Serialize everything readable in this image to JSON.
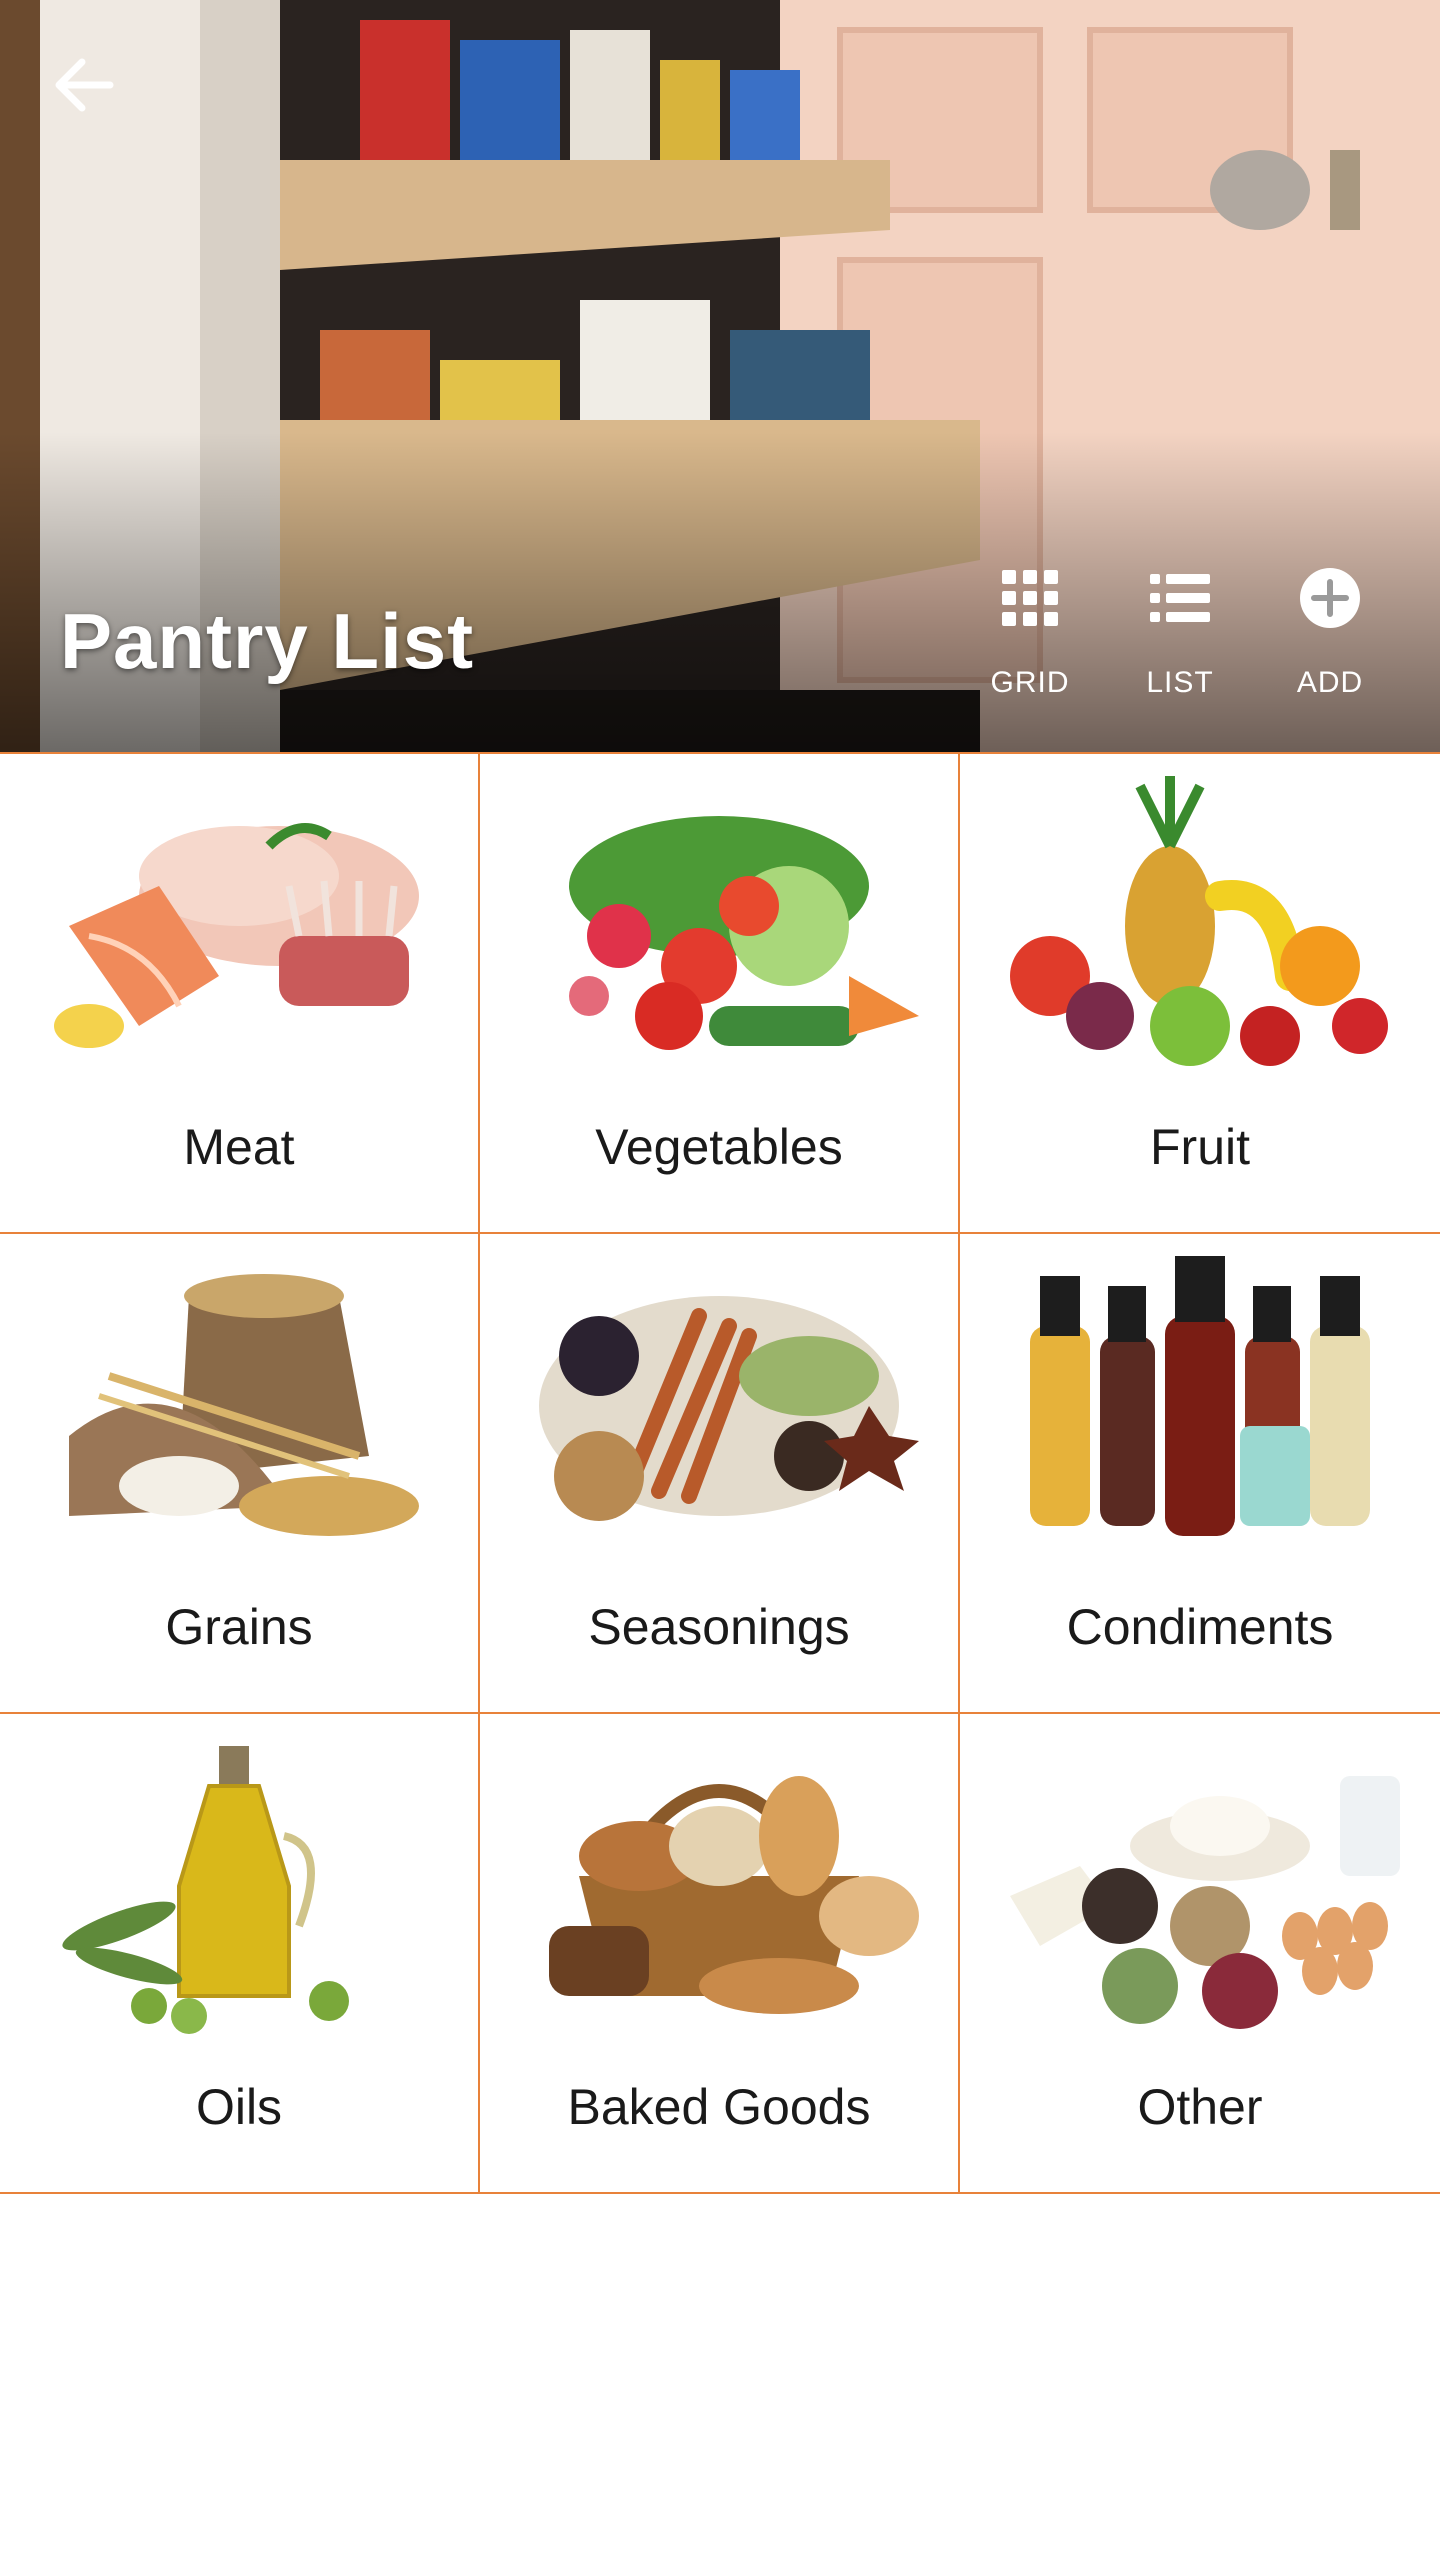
{
  "header": {
    "title": "Pantry List",
    "back_icon": "arrow-left-icon",
    "actions": [
      {
        "label": "GRID",
        "icon": "grid-icon"
      },
      {
        "label": "LIST",
        "icon": "list-icon"
      },
      {
        "label": "ADD",
        "icon": "add-circle-icon"
      }
    ]
  },
  "categories": [
    {
      "label": "Meat",
      "image": "meat-image"
    },
    {
      "label": "Vegetables",
      "image": "vegetables-image"
    },
    {
      "label": "Fruit",
      "image": "fruit-image"
    },
    {
      "label": "Grains",
      "image": "grains-image"
    },
    {
      "label": "Seasonings",
      "image": "seasonings-image"
    },
    {
      "label": "Condiments",
      "image": "condiments-image"
    },
    {
      "label": "Oils",
      "image": "oils-image"
    },
    {
      "label": "Baked Goods",
      "image": "baked-goods-image"
    },
    {
      "label": "Other",
      "image": "other-image"
    }
  ],
  "colors": {
    "divider": "#e8823a",
    "title_text": "#ffffff",
    "label_text": "#1a1a1a"
  }
}
